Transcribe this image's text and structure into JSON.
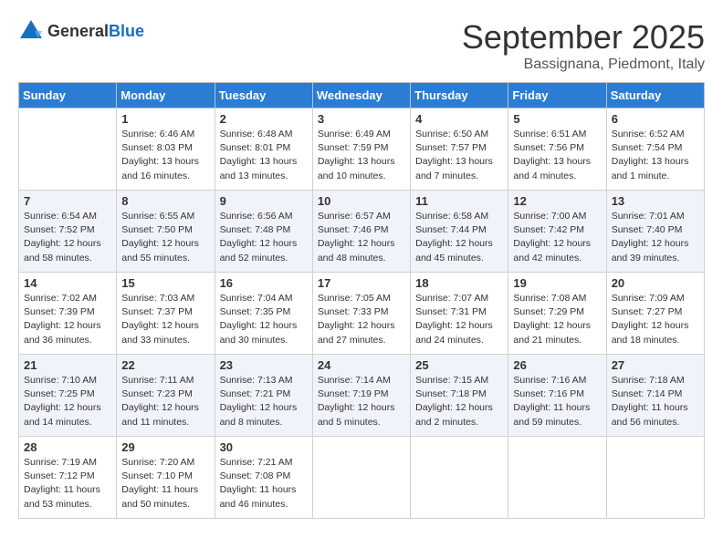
{
  "logo": {
    "general": "General",
    "blue": "Blue"
  },
  "title": "September 2025",
  "location": "Bassignana, Piedmont, Italy",
  "days_header": [
    "Sunday",
    "Monday",
    "Tuesday",
    "Wednesday",
    "Thursday",
    "Friday",
    "Saturday"
  ],
  "weeks": [
    [
      {
        "num": "",
        "info": ""
      },
      {
        "num": "1",
        "info": "Sunrise: 6:46 AM\nSunset: 8:03 PM\nDaylight: 13 hours\nand 16 minutes."
      },
      {
        "num": "2",
        "info": "Sunrise: 6:48 AM\nSunset: 8:01 PM\nDaylight: 13 hours\nand 13 minutes."
      },
      {
        "num": "3",
        "info": "Sunrise: 6:49 AM\nSunset: 7:59 PM\nDaylight: 13 hours\nand 10 minutes."
      },
      {
        "num": "4",
        "info": "Sunrise: 6:50 AM\nSunset: 7:57 PM\nDaylight: 13 hours\nand 7 minutes."
      },
      {
        "num": "5",
        "info": "Sunrise: 6:51 AM\nSunset: 7:56 PM\nDaylight: 13 hours\nand 4 minutes."
      },
      {
        "num": "6",
        "info": "Sunrise: 6:52 AM\nSunset: 7:54 PM\nDaylight: 13 hours\nand 1 minute."
      }
    ],
    [
      {
        "num": "7",
        "info": "Sunrise: 6:54 AM\nSunset: 7:52 PM\nDaylight: 12 hours\nand 58 minutes."
      },
      {
        "num": "8",
        "info": "Sunrise: 6:55 AM\nSunset: 7:50 PM\nDaylight: 12 hours\nand 55 minutes."
      },
      {
        "num": "9",
        "info": "Sunrise: 6:56 AM\nSunset: 7:48 PM\nDaylight: 12 hours\nand 52 minutes."
      },
      {
        "num": "10",
        "info": "Sunrise: 6:57 AM\nSunset: 7:46 PM\nDaylight: 12 hours\nand 48 minutes."
      },
      {
        "num": "11",
        "info": "Sunrise: 6:58 AM\nSunset: 7:44 PM\nDaylight: 12 hours\nand 45 minutes."
      },
      {
        "num": "12",
        "info": "Sunrise: 7:00 AM\nSunset: 7:42 PM\nDaylight: 12 hours\nand 42 minutes."
      },
      {
        "num": "13",
        "info": "Sunrise: 7:01 AM\nSunset: 7:40 PM\nDaylight: 12 hours\nand 39 minutes."
      }
    ],
    [
      {
        "num": "14",
        "info": "Sunrise: 7:02 AM\nSunset: 7:39 PM\nDaylight: 12 hours\nand 36 minutes."
      },
      {
        "num": "15",
        "info": "Sunrise: 7:03 AM\nSunset: 7:37 PM\nDaylight: 12 hours\nand 33 minutes."
      },
      {
        "num": "16",
        "info": "Sunrise: 7:04 AM\nSunset: 7:35 PM\nDaylight: 12 hours\nand 30 minutes."
      },
      {
        "num": "17",
        "info": "Sunrise: 7:05 AM\nSunset: 7:33 PM\nDaylight: 12 hours\nand 27 minutes."
      },
      {
        "num": "18",
        "info": "Sunrise: 7:07 AM\nSunset: 7:31 PM\nDaylight: 12 hours\nand 24 minutes."
      },
      {
        "num": "19",
        "info": "Sunrise: 7:08 AM\nSunset: 7:29 PM\nDaylight: 12 hours\nand 21 minutes."
      },
      {
        "num": "20",
        "info": "Sunrise: 7:09 AM\nSunset: 7:27 PM\nDaylight: 12 hours\nand 18 minutes."
      }
    ],
    [
      {
        "num": "21",
        "info": "Sunrise: 7:10 AM\nSunset: 7:25 PM\nDaylight: 12 hours\nand 14 minutes."
      },
      {
        "num": "22",
        "info": "Sunrise: 7:11 AM\nSunset: 7:23 PM\nDaylight: 12 hours\nand 11 minutes."
      },
      {
        "num": "23",
        "info": "Sunrise: 7:13 AM\nSunset: 7:21 PM\nDaylight: 12 hours\nand 8 minutes."
      },
      {
        "num": "24",
        "info": "Sunrise: 7:14 AM\nSunset: 7:19 PM\nDaylight: 12 hours\nand 5 minutes."
      },
      {
        "num": "25",
        "info": "Sunrise: 7:15 AM\nSunset: 7:18 PM\nDaylight: 12 hours\nand 2 minutes."
      },
      {
        "num": "26",
        "info": "Sunrise: 7:16 AM\nSunset: 7:16 PM\nDaylight: 11 hours\nand 59 minutes."
      },
      {
        "num": "27",
        "info": "Sunrise: 7:18 AM\nSunset: 7:14 PM\nDaylight: 11 hours\nand 56 minutes."
      }
    ],
    [
      {
        "num": "28",
        "info": "Sunrise: 7:19 AM\nSunset: 7:12 PM\nDaylight: 11 hours\nand 53 minutes."
      },
      {
        "num": "29",
        "info": "Sunrise: 7:20 AM\nSunset: 7:10 PM\nDaylight: 11 hours\nand 50 minutes."
      },
      {
        "num": "30",
        "info": "Sunrise: 7:21 AM\nSunset: 7:08 PM\nDaylight: 11 hours\nand 46 minutes."
      },
      {
        "num": "",
        "info": ""
      },
      {
        "num": "",
        "info": ""
      },
      {
        "num": "",
        "info": ""
      },
      {
        "num": "",
        "info": ""
      }
    ]
  ]
}
